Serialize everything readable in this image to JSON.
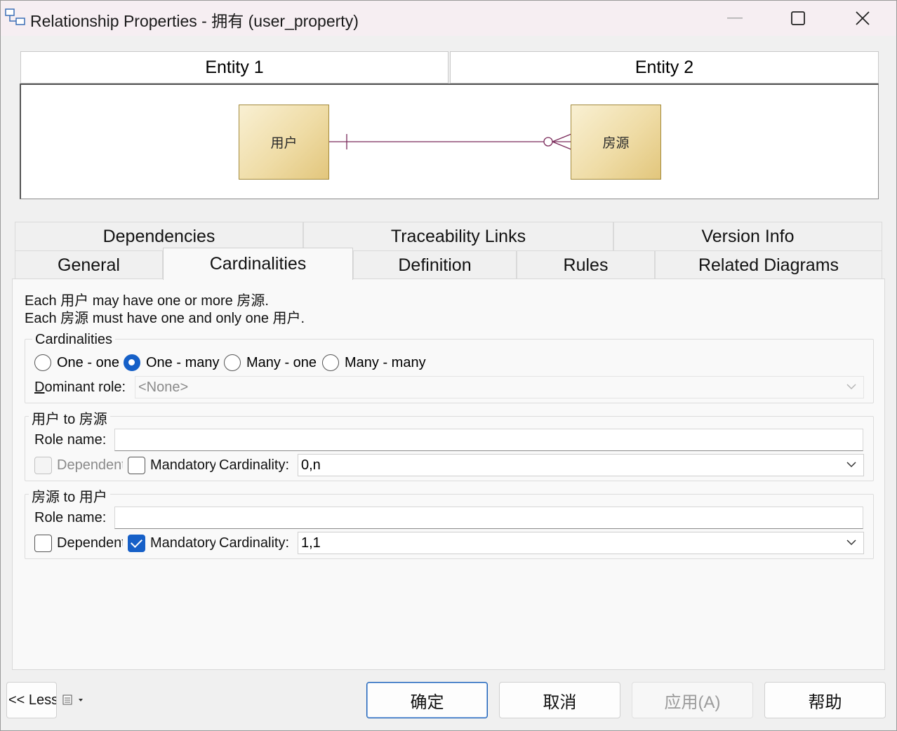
{
  "window": {
    "title": "Relationship Properties - 拥有 (user_property)"
  },
  "entity_tabs": [
    "Entity 1",
    "Entity 2"
  ],
  "diagram": {
    "entity1": "用户",
    "entity2": "房源"
  },
  "tabs": {
    "row1": [
      "Dependencies",
      "Traceability Links",
      "Version Info"
    ],
    "row2": [
      "General",
      "Cardinalities",
      "Definition",
      "Rules",
      "Related Diagrams"
    ],
    "active": "Cardinalities"
  },
  "description": {
    "line1": "Each 用户 may have one or more 房源.",
    "line2": "Each 房源 must have one and only one 用户."
  },
  "cardinalities": {
    "label": "Cardinalities",
    "options": [
      "One - one",
      "One - many",
      "Many - one",
      "Many - many"
    ],
    "selected": "One - many",
    "dominant_role_label": "Dominant role:",
    "dominant_role_value": "<None>"
  },
  "role1": {
    "label": "用户 to 房源",
    "role_name_label": "Role name:",
    "role_name_value": "",
    "dependent_label": "Dependent",
    "dependent_checked": false,
    "dependent_enabled": false,
    "mandatory_label": "Mandatory",
    "mandatory_checked": false,
    "cardinality_label": "Cardinality:",
    "cardinality_value": "0,n"
  },
  "role2": {
    "label": "房源 to 用户",
    "role_name_label": "Role name:",
    "role_name_value": "",
    "dependent_label": "Dependent",
    "dependent_checked": false,
    "dependent_enabled": true,
    "mandatory_label": "Mandatory",
    "mandatory_checked": true,
    "cardinality_label": "Cardinality:",
    "cardinality_value": "1,1"
  },
  "footer": {
    "less_label": "<< Less",
    "ok_label": "确定",
    "cancel_label": "取消",
    "apply_label": "应用(A)",
    "help_label": "帮助"
  },
  "colors": {
    "accent": "#1660c8",
    "entity_fill": "#efdca6",
    "relationship_line": "#7a2a5a",
    "titlebar": "#f6eef2"
  }
}
